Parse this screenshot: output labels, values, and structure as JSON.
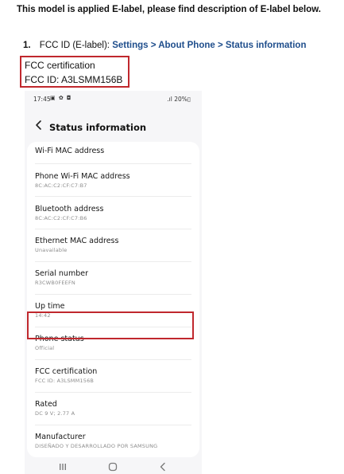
{
  "document": {
    "title": "This model is applied E-label, please find description of E-label below.",
    "step": {
      "number": "1.",
      "label": "FCC ID (E-label):",
      "path": "Settings > About Phone > Status information"
    },
    "fcc_box": {
      "line1": "FCC certification",
      "line2": "FCC ID: A3LSMM156B"
    }
  },
  "phone": {
    "status_bar": {
      "time": "17:45",
      "icons": [
        "image-icon",
        "gear-icon",
        "shield-icon"
      ],
      "icons_text": "▣ ✿ ◘",
      "battery": "20%",
      "signal_battery_text": ".ıl 20%▯"
    },
    "header": {
      "back_icon": "chevron-left-icon",
      "title": "Status information"
    },
    "rows": [
      {
        "title": "Wi-Fi MAC address",
        "value": ""
      },
      {
        "title": "Phone Wi-Fi MAC address",
        "value": "8C:AC:C2:CF:C7:B7"
      },
      {
        "title": "Bluetooth address",
        "value": "8C:AC:C2:CF:C7:B6"
      },
      {
        "title": "Ethernet MAC address",
        "value": "Unavailable"
      },
      {
        "title": "Serial number",
        "value": "R3CWB0FEEFN"
      },
      {
        "title": "Up time",
        "value": "14:42"
      },
      {
        "title": "Phone status",
        "value": "Official"
      },
      {
        "title": "FCC certification",
        "value": "FCC ID: A3LSMM156B"
      },
      {
        "title": "Rated",
        "value": "DC 9 V; 2.77 A"
      },
      {
        "title": "Manufacturer",
        "value": "DISEÑADO Y DESARROLLADO POR SAMSUNG"
      }
    ],
    "nav_bar": {
      "recents_icon": "recents-icon",
      "home_icon": "home-icon",
      "back_icon": "back-icon"
    }
  },
  "colors": {
    "highlight_red": "#c0282d",
    "path_blue": "#1f4e8c",
    "phone_background": "#f6f6f8",
    "card_background": "#ffffff",
    "secondary_text": "#8d8d8d"
  }
}
